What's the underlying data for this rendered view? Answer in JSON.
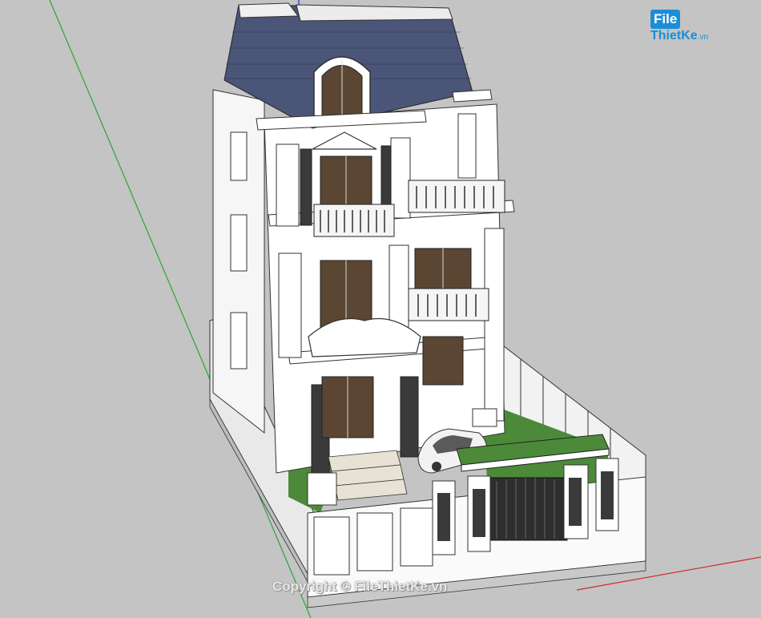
{
  "watermark": {
    "logo_file": "File",
    "logo_rest": "ThietKe",
    "logo_tld": ".vn",
    "copyright": "Copyright © FileThietKe.vn"
  },
  "colors": {
    "viewport_background": "#c4c4c4",
    "roof": "#4a5578",
    "wall": "#ffffff",
    "trim": "#2b2b2b",
    "glass": "#5a4632",
    "axis_green": "#2fa52f",
    "axis_blue": "#2a2acc",
    "axis_red": "#cc2a2a",
    "lawn": "#4c8a3a",
    "logo_blue": "#1a8fd6"
  },
  "icons": [
    "sketchup-axis-lines",
    "house-3d-model",
    "car-model"
  ]
}
